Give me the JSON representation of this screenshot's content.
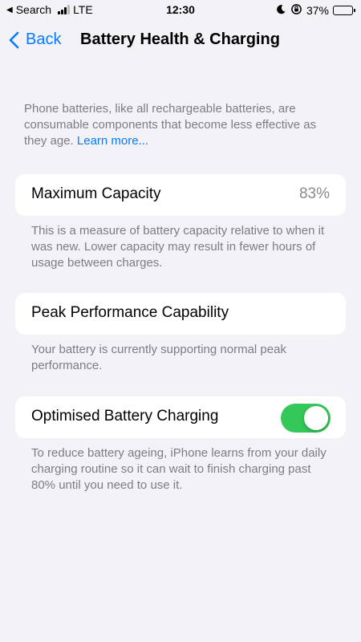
{
  "status_bar": {
    "back_app": "Search",
    "network": "LTE",
    "time": "12:30",
    "battery_percent": "37%",
    "battery_level": 0.37
  },
  "nav": {
    "back_label": "Back",
    "title": "Battery Health & Charging"
  },
  "intro": {
    "text": "Phone batteries, like all rechargeable batteries, are consumable components that become less effective as they age.",
    "link": "Learn more..."
  },
  "max_capacity": {
    "label": "Maximum Capacity",
    "value": "83%",
    "note": "This is a measure of battery capacity relative to when it was new. Lower capacity may result in fewer hours of usage between charges."
  },
  "peak_performance": {
    "label": "Peak Performance Capability",
    "note": "Your battery is currently supporting normal peak performance."
  },
  "optimised_charging": {
    "label": "Optimised Battery Charging",
    "enabled": true,
    "toggle_color": "#34c759",
    "note": "To reduce battery ageing, iPhone learns from your daily charging routine so it can wait to finish charging past 80% until you need to use it."
  },
  "colors": {
    "accent": "#0a7aff",
    "background": "#f2f2f7"
  }
}
